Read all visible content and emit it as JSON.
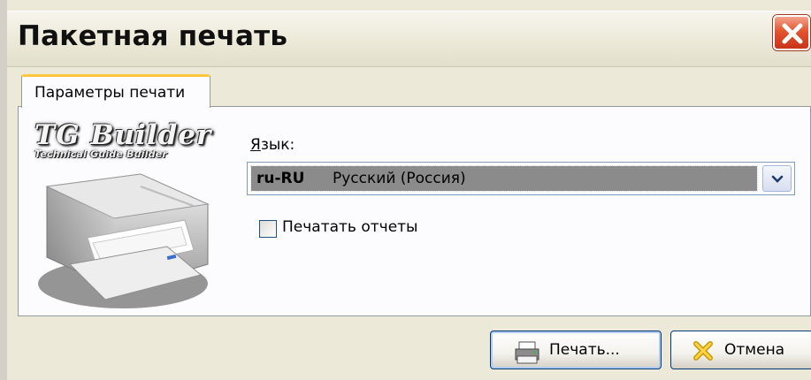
{
  "window": {
    "title": "Пакетная печать",
    "close_icon": "close-icon"
  },
  "tabs": [
    {
      "label": "Параметры печати",
      "active": true
    }
  ],
  "logo": {
    "title": "TG Builder",
    "subtitle": "Technical Guide Builder",
    "image": "printer-illustration"
  },
  "language": {
    "label": "Язык:",
    "label_accesskey": "Я",
    "selected_code": "ru-RU",
    "selected_name": "Русский (Россия)"
  },
  "print_reports": {
    "label": "Печатать отчеты",
    "checked": false
  },
  "buttons": {
    "print_label": "Печать...",
    "print_icon": "printer-icon",
    "cancel_label": "Отмена",
    "cancel_icon": "cancel-x-icon"
  },
  "colors": {
    "tab_accent": "#ffc83c",
    "close_button": "#e3542f",
    "selection": "#8b8b8b"
  }
}
